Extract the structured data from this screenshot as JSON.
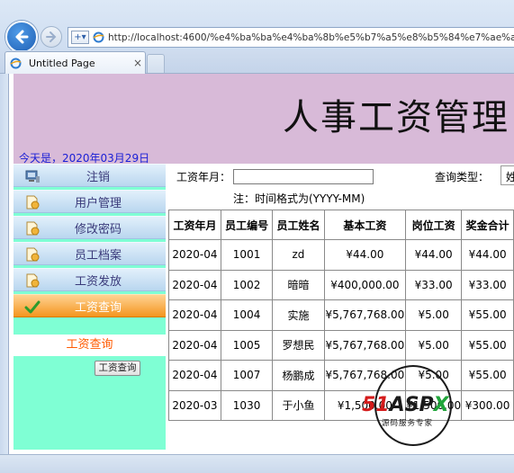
{
  "browser": {
    "url": "http://localhost:4600/%e4%ba%ba%e4%ba%8b%e5%b7%a5%e8%b5%84%e7%ae%a1%e7%",
    "url_host": "localhost",
    "tab_title": "Untitled Page",
    "tab_close": "×"
  },
  "page": {
    "banner_title": "人事工资管理",
    "date_text": "今天是，2020年03月29日"
  },
  "sidebar": {
    "items": [
      {
        "label": "注销",
        "icon": "monitor-icon",
        "active": false
      },
      {
        "label": "用户管理",
        "icon": "document-icon",
        "active": false
      },
      {
        "label": "修改密码",
        "icon": "document-icon",
        "active": false
      },
      {
        "label": "员工档案",
        "icon": "document-icon",
        "active": false
      },
      {
        "label": "工资发放",
        "icon": "document-icon",
        "active": false
      },
      {
        "label": "工资查询",
        "icon": "checkmark-icon",
        "active": true
      }
    ],
    "sub_title": "工资查询",
    "sub_button": "工资查询"
  },
  "query": {
    "month_label": "工资年月：",
    "month_value": "",
    "hint": "注：时间格式为(YYYY-MM)",
    "type_label": "查询类型：",
    "type_value": "姓"
  },
  "table": {
    "headers": [
      "工资年月",
      "员工编号",
      "员工姓名",
      "基本工资",
      "岗位工资",
      "奖金合计"
    ],
    "rows": [
      [
        "2020-04",
        "1001",
        "zd",
        "¥44.00",
        "¥44.00",
        "¥44.00"
      ],
      [
        "2020-04",
        "1002",
        "暗暗",
        "¥400,000.00",
        "¥33.00",
        "¥33.00"
      ],
      [
        "2020-04",
        "1004",
        "实施",
        "¥5,767,768.00",
        "¥5.00",
        "¥55.00"
      ],
      [
        "2020-04",
        "1005",
        "罗想民",
        "¥5,767,768.00",
        "¥5.00",
        "¥55.00"
      ],
      [
        "2020-04",
        "1007",
        "杨鹏成",
        "¥5,767,768.00",
        "¥5.00",
        "¥55.00"
      ],
      [
        "2020-03",
        "1030",
        "于小鱼",
        "¥1,500.00",
        "¥1,500.00",
        "¥300.00"
      ]
    ]
  },
  "watermark": {
    "brand_51": "51",
    "brand_asp": "ASP",
    "brand_x": "X",
    "tagline": "源码服务专家"
  },
  "colors": {
    "banner": "#d8bad8",
    "sidebar": "#7fffd4",
    "date_text": "#1b20d6",
    "active_menu": "#f4951f",
    "sub_title": "#ff5a00"
  }
}
